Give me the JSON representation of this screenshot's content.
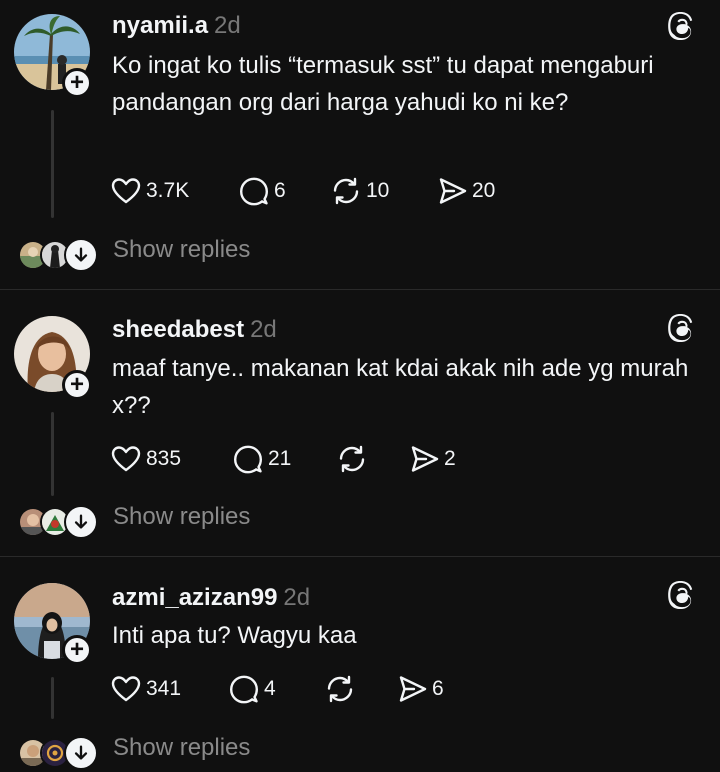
{
  "posts": [
    {
      "username": "nyamii.a",
      "time": "2d",
      "text": "Ko ingat ko tulis “termasuk sst” tu dapat mengaburi pandangan org dari harga yahudi ko ni ke?",
      "likes": "3.7K",
      "comments": "6",
      "reposts": "10",
      "shares": "20",
      "show_replies": "Show replies"
    },
    {
      "username": "sheedabest",
      "time": "2d",
      "text": "maaf tanye.. makanan kat kdai akak nih ade yg murah x??",
      "likes": "835",
      "comments": "21",
      "reposts": "",
      "shares": "2",
      "show_replies": "Show replies"
    },
    {
      "username": "azmi_azizan99",
      "time": "2d",
      "text": "Inti apa tu? Wagyu kaa",
      "likes": "341",
      "comments": "4",
      "reposts": "",
      "shares": "6",
      "show_replies": "Show replies"
    }
  ],
  "icons": {
    "like": "heart-icon",
    "comment": "comment-icon",
    "repost": "repost-icon",
    "share": "share-icon",
    "app": "threads-logo-icon",
    "follow": "plus-icon",
    "expand": "arrow-down-icon"
  },
  "colors": {
    "background": "#101010",
    "text": "#f3f5f7",
    "muted": "#8a8a8a"
  }
}
